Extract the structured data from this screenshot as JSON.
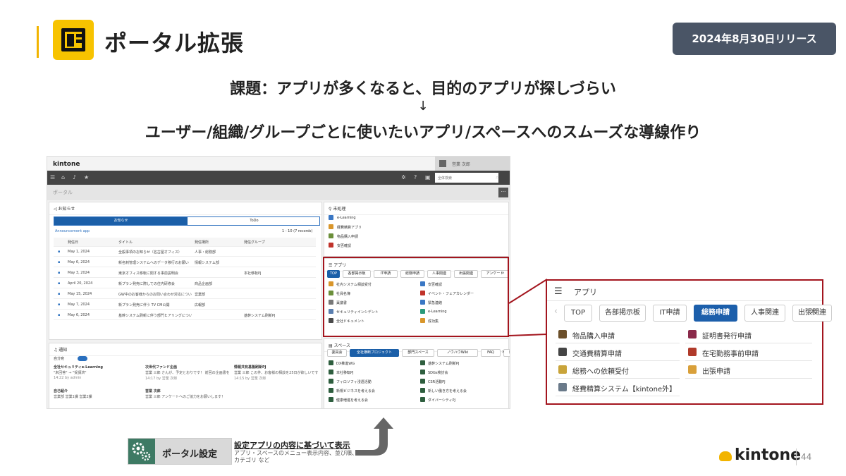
{
  "slide": {
    "title": "ポータル拡張",
    "release_badge": "2024年8月30日リリース",
    "subtitle_line1": "課題：アプリが多くなると、目的のアプリが探しづらい",
    "subtitle_arrow": "↓",
    "subtitle_line2": "ユーザー/組織/グループごとに使いたいアプリ/スペースへのスムーズな導線作り",
    "page_number": "44",
    "brand_logo": "kintone"
  },
  "screenshot": {
    "brand": "kintone",
    "user_name": "営業 次郎",
    "search_placeholder": "全体検索",
    "page_heading": "ポータル",
    "notices": {
      "header": "お知らせ",
      "tab_notices": "お知らせ",
      "tab_todo": "ToDo",
      "app_name": "Announcement app",
      "count": "1 - 10 (7 records)",
      "columns": [
        "発信日",
        "タイトル",
        "発信場所",
        "発信グループ"
      ],
      "rows": [
        [
          "May 1, 2024",
          "全般事項のお知らせ（名古屋オフィス）",
          "人事・総務部",
          ""
        ],
        [
          "May 6, 2024",
          "新名刺管理システムへのデータ移行のお願い",
          "情報システム部",
          ""
        ],
        [
          "May 3, 2024",
          "東京オフィス移転に関する事前説明会",
          "",
          "本社移転PJ"
        ],
        [
          "April 20, 2024",
          "新プラン発売に際しての住内研修会",
          "商品企画部",
          ""
        ],
        [
          "May 15, 2024",
          "GW中のお客様からのお問い合わせ対応について",
          "営業部",
          ""
        ],
        [
          "May 7, 2024",
          "新プラン発売に伴う TV CM公開",
          "広報部",
          ""
        ],
        [
          "May 6, 2024",
          "基幹システム刷新に伴う部門ヒアリングについて",
          "",
          "基幹システム刷新PJ"
        ]
      ]
    },
    "pending": {
      "header": "未処理",
      "items": [
        "e-Learning",
        "経費精算アプリ",
        "物品購入申請",
        "安否確認"
      ]
    },
    "apps": {
      "header": "アプリ",
      "tabs": [
        "TOP",
        "各部掲示板",
        "IT申請",
        "総務申請",
        "人事関連",
        "出張関連",
        "アンケート"
      ],
      "items": [
        "社内システム相談受付",
        "安否確認",
        "社員名簿",
        "イベント・フェアカレンダー",
        "稟議書",
        "緊急連絡",
        "セキュリティインシデント",
        "e-Learning",
        "全社ドキュメント",
        "成功集"
      ]
    },
    "notify": {
      "header": "通知",
      "filter": "自分宛",
      "entries": [
        {
          "title": "全社セキュリティe-Learning",
          "sub": "\"未回答\" → \"受講済\"",
          "meta": "14:22 by admin"
        },
        {
          "title": "次世代ファンド企画",
          "sub": "営業 三郎 さんが、予定とおりです！ 前回の企画書をご確認ください",
          "meta": "14:17 by 営業 次郎"
        },
        {
          "title": "情報共有基盤刷新PJ",
          "sub": "営業 三郎 この件、お客様の相談を25日が欲しいです",
          "meta": "14:15 by 営業 次郎"
        },
        {
          "title": "自己紹介",
          "sub": "営業部 営業1課 営業2課",
          "meta": ""
        },
        {
          "title": "営業 次郎",
          "sub": "営業 三郎 アンケートへのご協力をお願いします！",
          "meta": ""
        }
      ]
    },
    "spaces": {
      "header": "スペース",
      "tabs": [
        "委員会",
        "全社横断プロジェクト",
        "部門スペース",
        "ノウハウWiki",
        "FAQ",
        "雑談スレッド"
      ],
      "items": [
        "DX推進WG",
        "基幹システム刷新PJ",
        "本社移転PJ",
        "SDGs検討会",
        "フィロソフィ浸透活動",
        "CSR活動PJ",
        "新規ビジネスを考える会",
        "新しい働き方を考える会",
        "健康増進を考える会",
        "ダイバーシティPJ"
      ]
    }
  },
  "zoom": {
    "header": "アプリ",
    "tabs": [
      "TOP",
      "各部掲示板",
      "IT申請",
      "総務申請",
      "人事関連",
      "出張関連"
    ],
    "active_tab": "総務申請",
    "items_left": [
      "物品購入申請",
      "交通費精算申請",
      "総務への依頼受付",
      "経費精算システム【kintone外】"
    ],
    "items_right": [
      "証明書発行申請",
      "在宅勤務事前申請",
      "出張申請"
    ]
  },
  "portal_settings": {
    "label": "ポータル設定",
    "note_title": "設定アプリの内容に基づいて表示",
    "note_body": "アプリ・スペースのメニュー表示内容、並び順、カテゴリ など"
  },
  "colors": {
    "accent": "#f2b400",
    "badge": "#4a5566",
    "highlight": "#a3151e",
    "active_tab": "#1c5fab"
  }
}
